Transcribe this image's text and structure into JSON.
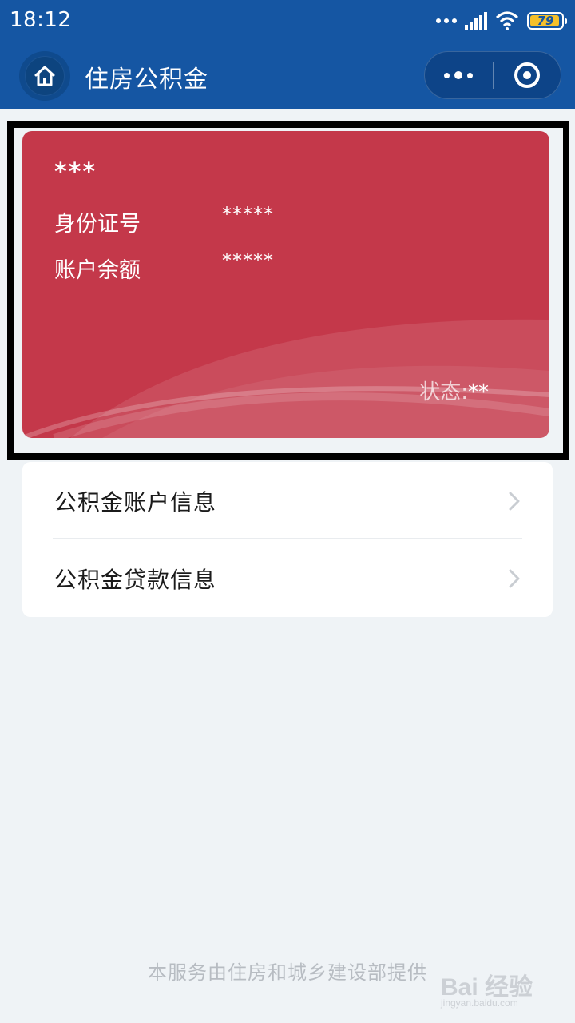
{
  "status_bar": {
    "time": "18:12",
    "battery": "79",
    "icons": [
      "dots-icon",
      "signal-icon",
      "wifi-icon",
      "battery-icon"
    ]
  },
  "nav": {
    "title": "住房公积金",
    "home_icon": "home-icon",
    "more_icon": "more-dots-icon",
    "close_icon": "target-icon"
  },
  "card": {
    "name": "***",
    "id_label": "身份证号",
    "id_value": "*****",
    "balance_label": "账户余额",
    "balance_value": "*****",
    "status_label": "状态:",
    "status_value": "**",
    "background_color": "#c4384a"
  },
  "menu": {
    "items": [
      {
        "label": "公积金账户信息"
      },
      {
        "label": "公积金贷款信息"
      }
    ]
  },
  "footer": {
    "text": "本服务由住房和城乡建设部提供"
  },
  "watermark": {
    "text": "Bai 经验",
    "sub": "jingyan.baidu.com"
  },
  "colors": {
    "header": "#1556a3",
    "page_bg": "#eff3f6",
    "card": "#c4384a"
  }
}
